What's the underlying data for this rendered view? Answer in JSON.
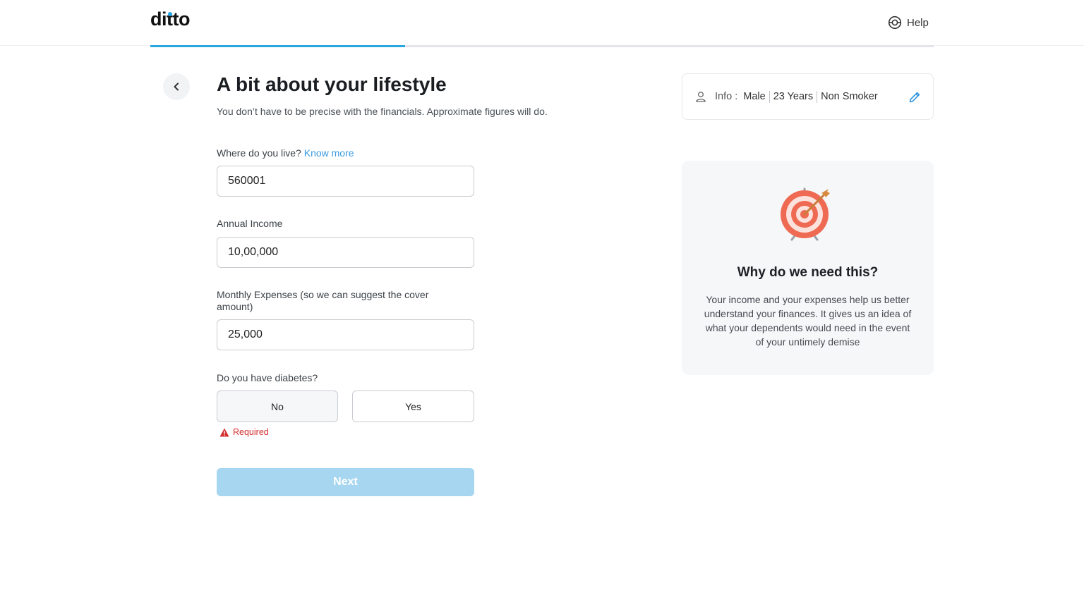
{
  "header": {
    "logo": "ditto",
    "help_label": "Help"
  },
  "progress": {
    "fraction": 0.325
  },
  "page": {
    "title": "A bit about your lifestyle",
    "subtitle": "You don’t have to be precise with the financials. Approximate figures will do."
  },
  "form": {
    "location": {
      "label": "Where do you live?",
      "link": "Know more",
      "value": "560001"
    },
    "income": {
      "label": "Annual Income",
      "value": "10,00,000"
    },
    "expenses": {
      "label": "Monthly Expenses (so we can suggest the cover amount)",
      "value": "25,000"
    },
    "diabetes": {
      "label": "Do you have diabetes?",
      "options": [
        "No",
        "Yes"
      ],
      "error": "Required"
    },
    "next_label": "Next"
  },
  "info": {
    "label": "Info :",
    "gender": "Male",
    "age": "23 Years",
    "smoker": "Non Smoker"
  },
  "why": {
    "title": "Why do we need this?",
    "text": "Your income and your expenses help us better understand your finances. It gives us an idea of what your dependents would need in the event of your untimely demise"
  },
  "colors": {
    "accent": "#29a8e0",
    "error": "#d32f2f",
    "next_disabled": "#a6d6f0"
  }
}
